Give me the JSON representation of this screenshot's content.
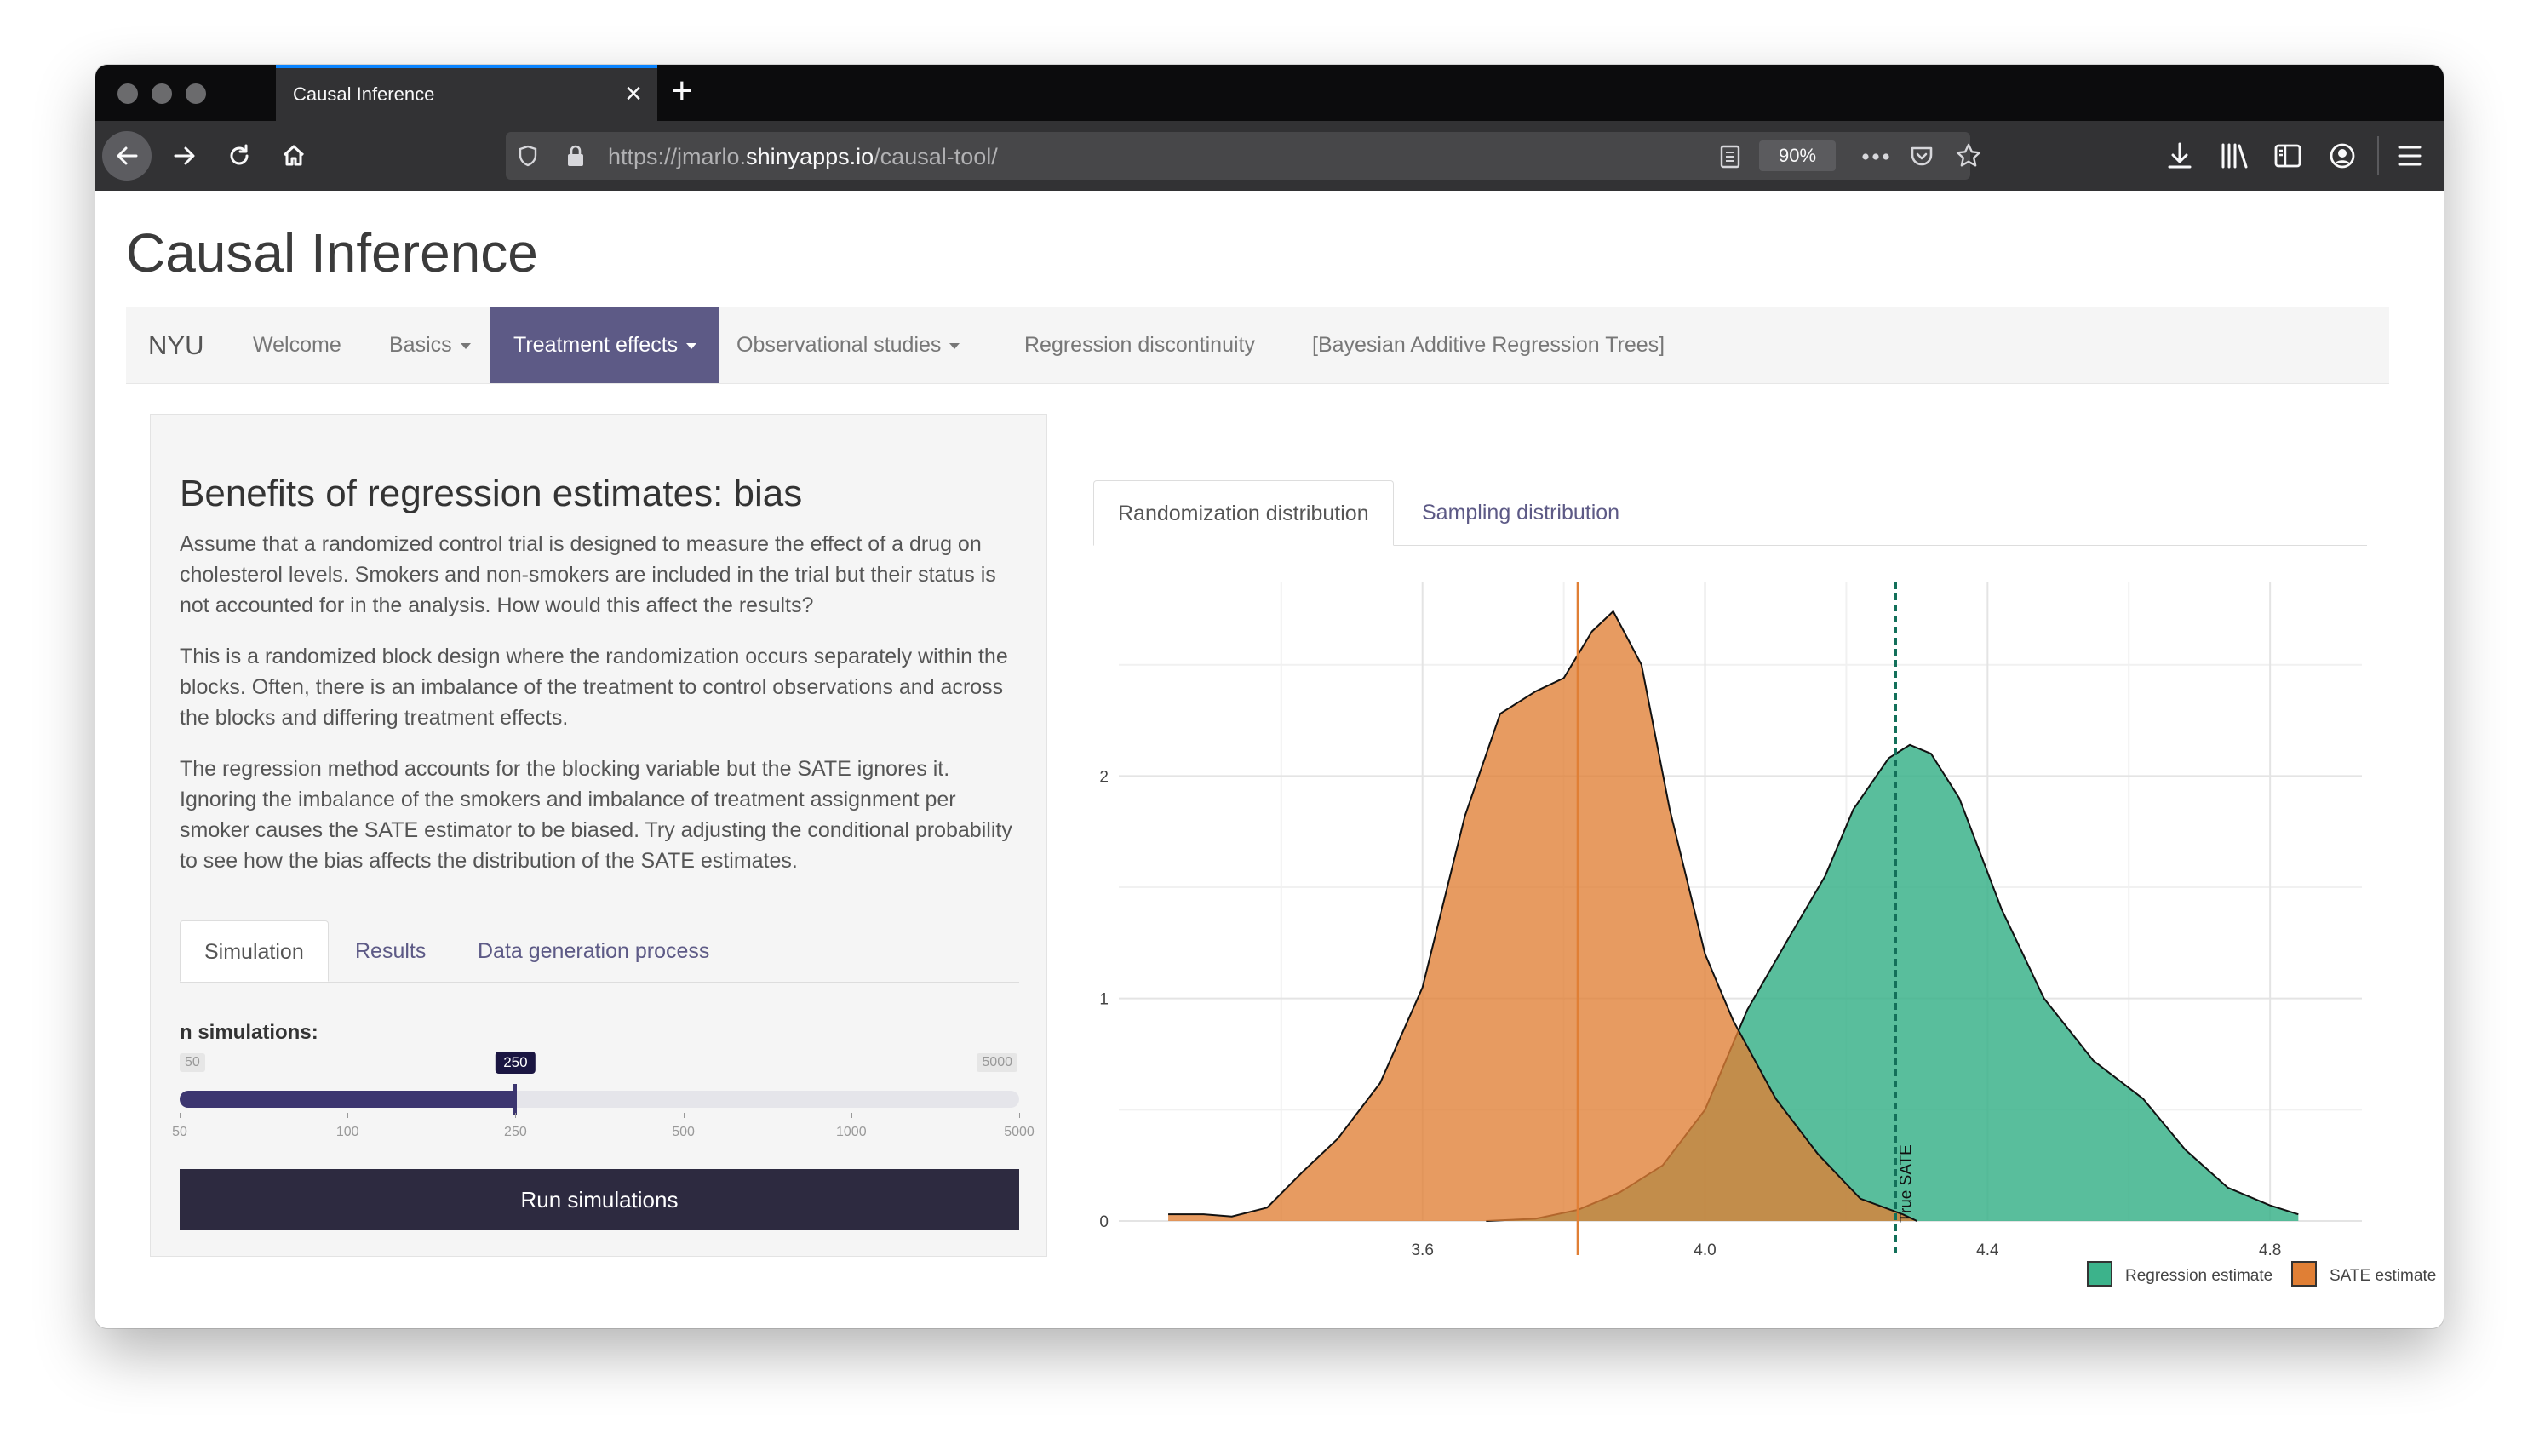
{
  "browser": {
    "tab_title": "Causal Inference",
    "url_prefix": "https://jmarlo.",
    "url_domain": "shinyapps.io",
    "url_path": "/causal-tool/",
    "zoom": "90%"
  },
  "app": {
    "title": "Causal Inference",
    "brand": "NYU",
    "nav": [
      {
        "label": "Welcome"
      },
      {
        "label": "Basics"
      },
      {
        "label": "Treatment effects"
      },
      {
        "label": "Observational studies"
      },
      {
        "label": "Regression discontinuity"
      },
      {
        "label": "[Bayesian Additive Regression Trees]"
      }
    ]
  },
  "sidebar": {
    "heading": "Benefits of regression estimates: bias",
    "paragraphs": [
      "Assume that a randomized control trial is designed to measure the effect of a drug on cholesterol levels. Smokers and non-smokers are included in the trial but their status is not accounted for in the analysis. How would this affect the results?",
      "This is a randomized block design where the randomization occurs separately within the blocks. Often, there is an imbalance of the treatment to control observations and across the blocks and differing treatment effects.",
      "The regression method accounts for the blocking variable but the SATE ignores it. Ignoring the imbalance of the smokers and imbalance of treatment assignment per smoker causes the SATE estimator to be biased. Try adjusting the conditional probability to see how the bias affects the distribution of the SATE estimates."
    ],
    "tabs": [
      "Simulation",
      "Results",
      "Data generation process"
    ],
    "slider": {
      "label": "n simulations:",
      "min": "50",
      "max": "5000",
      "value": "250",
      "ticks": [
        "50",
        "100",
        "250",
        "500",
        "1000",
        "5000"
      ],
      "fill_fraction": 0.4
    },
    "run_button": "Run simulations"
  },
  "main": {
    "tabs": [
      "Randomization distribution",
      "Sampling distribution"
    ]
  },
  "chart_data": {
    "type": "area",
    "title": "",
    "xlabel": "",
    "ylabel": "",
    "xlim": [
      3.17,
      4.93
    ],
    "ylim": [
      0,
      2.87
    ],
    "x_ticks": [
      "3.6",
      "4.0",
      "4.4",
      "4.8"
    ],
    "y_ticks": [
      "0",
      "1",
      "2"
    ],
    "grid": true,
    "legend_position": "bottom-right",
    "series": [
      {
        "name": "Regression estimate",
        "color": "#3cb38b",
        "points": [
          [
            3.69,
            0
          ],
          [
            3.76,
            0.01
          ],
          [
            3.82,
            0.05
          ],
          [
            3.88,
            0.13
          ],
          [
            3.94,
            0.25
          ],
          [
            4.0,
            0.5
          ],
          [
            4.06,
            0.95
          ],
          [
            4.12,
            1.28
          ],
          [
            4.17,
            1.55
          ],
          [
            4.21,
            1.85
          ],
          [
            4.26,
            2.08
          ],
          [
            4.29,
            2.14
          ],
          [
            4.32,
            2.1
          ],
          [
            4.36,
            1.9
          ],
          [
            4.42,
            1.4
          ],
          [
            4.48,
            1.0
          ],
          [
            4.55,
            0.72
          ],
          [
            4.62,
            0.55
          ],
          [
            4.68,
            0.32
          ],
          [
            4.74,
            0.15
          ],
          [
            4.8,
            0.07
          ],
          [
            4.84,
            0.03
          ]
        ]
      },
      {
        "name": "SATE estimate",
        "color": "#e07f35",
        "points": [
          [
            3.24,
            0.03
          ],
          [
            3.29,
            0.03
          ],
          [
            3.33,
            0.02
          ],
          [
            3.38,
            0.06
          ],
          [
            3.43,
            0.22
          ],
          [
            3.48,
            0.37
          ],
          [
            3.54,
            0.62
          ],
          [
            3.6,
            1.05
          ],
          [
            3.66,
            1.82
          ],
          [
            3.71,
            2.28
          ],
          [
            3.76,
            2.38
          ],
          [
            3.8,
            2.44
          ],
          [
            3.84,
            2.65
          ],
          [
            3.87,
            2.74
          ],
          [
            3.91,
            2.5
          ],
          [
            3.95,
            1.85
          ],
          [
            4.0,
            1.2
          ],
          [
            4.04,
            0.9
          ],
          [
            4.1,
            0.55
          ],
          [
            4.16,
            0.3
          ],
          [
            4.22,
            0.1
          ],
          [
            4.28,
            0.03
          ],
          [
            4.3,
            0
          ]
        ]
      }
    ],
    "vlines": [
      {
        "x": 3.82,
        "color": "#e07f35",
        "style": "solid"
      },
      {
        "x": 4.27,
        "color": "#13705a",
        "style": "dashed",
        "label": "True SATE"
      }
    ]
  }
}
